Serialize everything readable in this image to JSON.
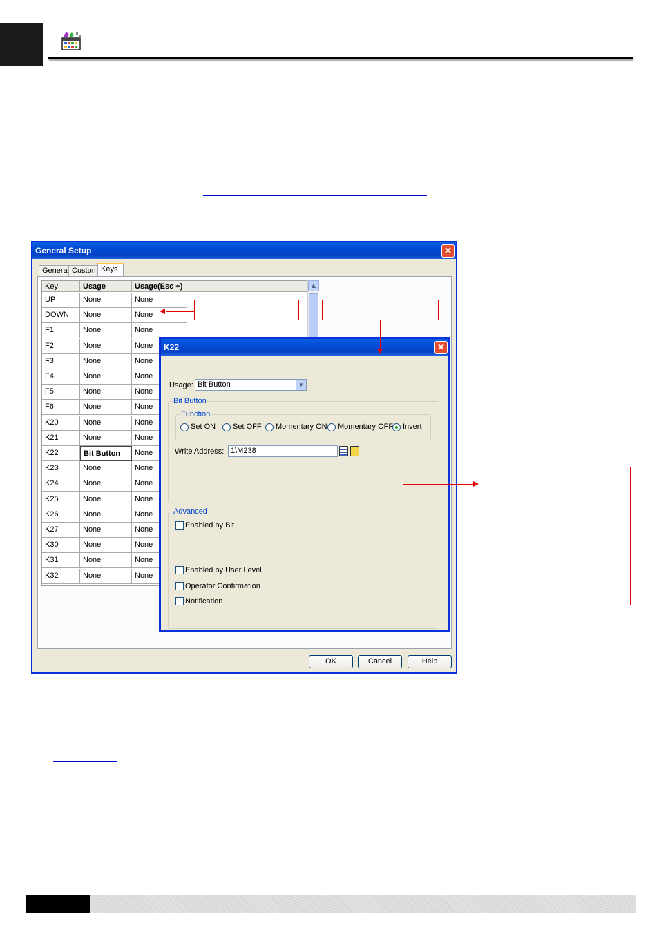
{
  "general_setup": {
    "title": "General Setup",
    "tabs": [
      "General",
      "Custom",
      "Keys"
    ],
    "active_tab": "Keys",
    "columns": [
      "Key",
      "Usage",
      "Usage(Esc +)"
    ],
    "rows": [
      {
        "key": "UP",
        "usage": "None",
        "usage_esc": "None"
      },
      {
        "key": "DOWN",
        "usage": "None",
        "usage_esc": "None"
      },
      {
        "key": "F1",
        "usage": "None",
        "usage_esc": "None"
      },
      {
        "key": "F2",
        "usage": "None",
        "usage_esc": "None"
      },
      {
        "key": "F3",
        "usage": "None",
        "usage_esc": "None"
      },
      {
        "key": "F4",
        "usage": "None",
        "usage_esc": "None"
      },
      {
        "key": "F5",
        "usage": "None",
        "usage_esc": "None"
      },
      {
        "key": "F6",
        "usage": "None",
        "usage_esc": "None"
      },
      {
        "key": "K20",
        "usage": "None",
        "usage_esc": "None"
      },
      {
        "key": "K21",
        "usage": "None",
        "usage_esc": "None"
      },
      {
        "key": "K22",
        "usage": "Bit Button",
        "usage_esc": "None",
        "selected": true
      },
      {
        "key": "K23",
        "usage": "None",
        "usage_esc": "None"
      },
      {
        "key": "K24",
        "usage": "None",
        "usage_esc": "None"
      },
      {
        "key": "K25",
        "usage": "None",
        "usage_esc": "None"
      },
      {
        "key": "K26",
        "usage": "None",
        "usage_esc": "None"
      },
      {
        "key": "K27",
        "usage": "None",
        "usage_esc": "None"
      },
      {
        "key": "K30",
        "usage": "None",
        "usage_esc": "None"
      },
      {
        "key": "K31",
        "usage": "None",
        "usage_esc": "None"
      },
      {
        "key": "K32",
        "usage": "None",
        "usage_esc": "None"
      }
    ],
    "buttons": {
      "ok": "OK",
      "cancel": "Cancel",
      "help": "Help"
    }
  },
  "k22_dialog": {
    "title": "K22",
    "usage_label": "Usage:",
    "usage_value": "Bit Button",
    "bit_button_group": "Bit Button",
    "function_group": "Function",
    "function_options": [
      "Set ON",
      "Set OFF",
      "Momentary ON",
      "Momentary OFF",
      "Invert"
    ],
    "function_selected": "Invert",
    "write_address_label": "Write Address:",
    "write_address_value": "1\\M238",
    "advanced_group": "Advanced",
    "checkboxes": {
      "enabled_by_bit": "Enabled by Bit",
      "enabled_by_user_level": "Enabled by User Level",
      "operator_confirmation": "Operator Confirmation",
      "notification": "Notification"
    }
  },
  "colors": {
    "callout_red": "#e00000",
    "xp_title_blue": "#0348d4",
    "group_label_blue": "#0046d5"
  },
  "icons": [
    "app-palette-icon",
    "close-icon",
    "chevron-down-icon",
    "calculator-icon",
    "address-book-icon"
  ]
}
